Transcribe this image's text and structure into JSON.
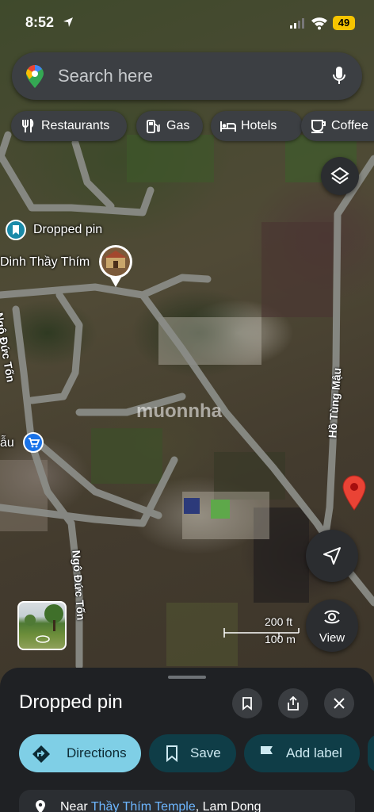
{
  "status_bar": {
    "time": "8:52",
    "battery": "49"
  },
  "search": {
    "placeholder": "Search here"
  },
  "chips": [
    {
      "label": "Restaurants",
      "icon": "fork-knife-icon"
    },
    {
      "label": "Gas",
      "icon": "gas-pump-icon"
    },
    {
      "label": "Hotels",
      "icon": "bed-icon"
    },
    {
      "label": "Coffee",
      "icon": "coffee-cup-icon"
    }
  ],
  "map": {
    "places": {
      "dropped_pin": "Dropped pin",
      "temple": "Dinh Thầy Thím",
      "shop": "ẫu"
    },
    "roads": {
      "ngo_duc_ton_upper": "Ngô Đức Tốn",
      "ngo_duc_ton_lower": "Ngô Đức Tốn",
      "ho_tung_mau": "Hồ Tùng Mậu"
    },
    "watermark": "muonnha",
    "scale": {
      "ft": "200 ft",
      "m": "100 m"
    },
    "view_label": "View"
  },
  "sheet": {
    "title": "Dropped pin",
    "actions": {
      "directions": "Directions",
      "save": "Save",
      "add_label": "Add label"
    },
    "near": {
      "prefix": "Near ",
      "place": "Thầy Thím Temple",
      "suffix": ", Lam Dong"
    }
  },
  "colors": {
    "accent": "#7fcfe6",
    "chip_bg": "#3c3f43",
    "pin_red": "#ea4335"
  }
}
